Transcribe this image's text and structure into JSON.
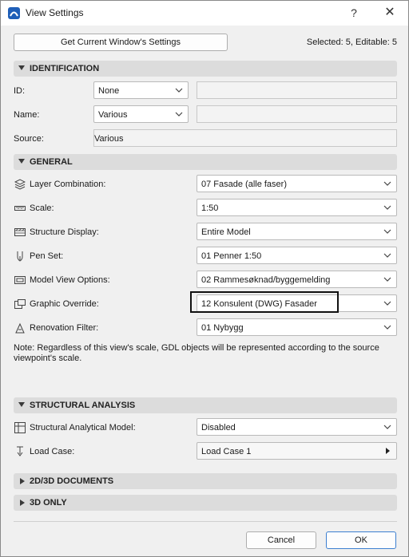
{
  "window": {
    "title": "View Settings",
    "help": "?",
    "close": "✕"
  },
  "header": {
    "get_settings_label": "Get Current Window's Settings",
    "selected_info": "Selected: 5, Editable: 5"
  },
  "identification": {
    "section_label": "IDENTIFICATION",
    "id_label": "ID:",
    "id_value": "None",
    "name_label": "Name:",
    "name_value": "Various",
    "source_label": "Source:",
    "source_value": "Various"
  },
  "general": {
    "section_label": "GENERAL",
    "rows": [
      {
        "label": "Layer Combination:",
        "value": "07 Fasade (alle faser)",
        "icon": "layers-icon"
      },
      {
        "label": "Scale:",
        "value": "1:50",
        "icon": "ruler-icon"
      },
      {
        "label": "Structure Display:",
        "value": "Entire Model",
        "icon": "structure-icon"
      },
      {
        "label": "Pen Set:",
        "value": "01 Penner 1:50",
        "icon": "pen-icon"
      },
      {
        "label": "Model View Options:",
        "value": "02 Rammesøknad/byggemelding",
        "icon": "model-view-icon"
      },
      {
        "label": "Graphic Override:",
        "value": "12 Konsulent (DWG) Fasader",
        "icon": "graphic-override-icon"
      },
      {
        "label": "Renovation Filter:",
        "value": "01 Nybygg",
        "icon": "renovation-icon"
      }
    ],
    "note": "Note: Regardless of this view's scale, GDL objects will be represented according to the source viewpoint's scale."
  },
  "structural": {
    "section_label": "STRUCTURAL ANALYSIS",
    "model_label": "Structural Analytical Model:",
    "model_value": "Disabled",
    "load_label": "Load Case:",
    "load_value": "Load Case 1"
  },
  "collapsed_sections": {
    "docs_label": "2D/3D DOCUMENTS",
    "three_d_label": "3D ONLY"
  },
  "footer": {
    "cancel_label": "Cancel",
    "ok_label": "OK"
  },
  "colors": {
    "accent": "#1f5fb8",
    "section_bg": "#dcdcdc",
    "ok_border": "#3c7fd0"
  }
}
